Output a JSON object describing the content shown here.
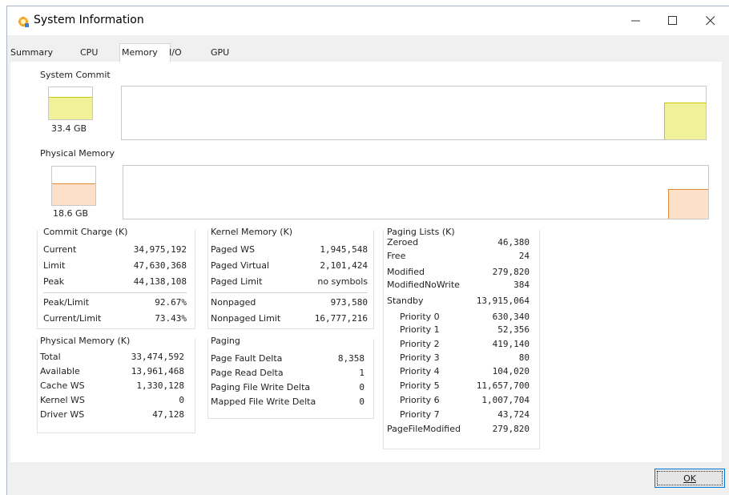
{
  "window": {
    "title": "System Information",
    "controls": {
      "minimize": "—",
      "maximize": "☐",
      "close": "✕"
    }
  },
  "tabs": [
    {
      "label": "Summary"
    },
    {
      "label": "CPU"
    },
    {
      "label": "Memory",
      "active": true
    },
    {
      "label": "I/O"
    },
    {
      "label": "GPU"
    }
  ],
  "system_commit": {
    "label": "System Commit",
    "value": "33.4 GB",
    "fill_fraction": 0.7,
    "color": "#f1f19a",
    "line_color": "#c8c800"
  },
  "physical_memory_graph": {
    "label": "Physical Memory",
    "value": "18.6 GB",
    "fill_fraction": 0.56,
    "color": "#fce1c8",
    "line_color": "#e08a3c"
  },
  "commit_charge": {
    "label": "Commit Charge (K)",
    "rows": [
      {
        "k": "Current",
        "v": "34,975,192"
      },
      {
        "k": "Limit",
        "v": "47,630,368"
      },
      {
        "k": "Peak",
        "v": "44,138,108"
      },
      {
        "k": "Peak/Limit",
        "v": "92.67%"
      },
      {
        "k": "Current/Limit",
        "v": "73.43%"
      }
    ]
  },
  "physical_memory": {
    "label": "Physical Memory (K)",
    "rows": [
      {
        "k": "Total",
        "v": "33,474,592"
      },
      {
        "k": "Available",
        "v": "13,961,468"
      },
      {
        "k": "Cache WS",
        "v": "1,330,128"
      },
      {
        "k": "Kernel WS",
        "v": "0"
      },
      {
        "k": "Driver WS",
        "v": "47,128"
      }
    ]
  },
  "kernel_memory": {
    "label": "Kernel Memory (K)",
    "rows": [
      {
        "k": "Paged WS",
        "v": "1,945,548"
      },
      {
        "k": "Paged Virtual",
        "v": "2,101,424"
      },
      {
        "k": "Paged Limit",
        "v": "no symbols"
      },
      {
        "k": "Nonpaged",
        "v": "973,580"
      },
      {
        "k": "Nonpaged Limit",
        "v": "16,777,216"
      }
    ]
  },
  "paging": {
    "label": "Paging",
    "rows": [
      {
        "k": "Page Fault Delta",
        "v": "8,358"
      },
      {
        "k": "Page Read Delta",
        "v": "1"
      },
      {
        "k": "Paging File Write Delta",
        "v": "0"
      },
      {
        "k": "Mapped File Write Delta",
        "v": "0"
      }
    ]
  },
  "paging_lists": {
    "label": "Paging Lists (K)",
    "rows": [
      {
        "k": "Zeroed",
        "v": "46,380"
      },
      {
        "k": "Free",
        "v": "24"
      },
      {
        "k": "Modified",
        "v": "279,820"
      },
      {
        "k": "ModifiedNoWrite",
        "v": "384"
      },
      {
        "k": "Standby",
        "v": "13,915,064"
      },
      {
        "k": "Priority 0",
        "v": "630,340"
      },
      {
        "k": "Priority 1",
        "v": "52,356"
      },
      {
        "k": "Priority 2",
        "v": "419,140"
      },
      {
        "k": "Priority 3",
        "v": "80"
      },
      {
        "k": "Priority 4",
        "v": "104,020"
      },
      {
        "k": "Priority 5",
        "v": "11,657,700"
      },
      {
        "k": "Priority 6",
        "v": "1,007,704"
      },
      {
        "k": "Priority 7",
        "v": "43,724"
      },
      {
        "k": "PageFileModified",
        "v": "279,820"
      }
    ]
  },
  "ok_button": "OK"
}
